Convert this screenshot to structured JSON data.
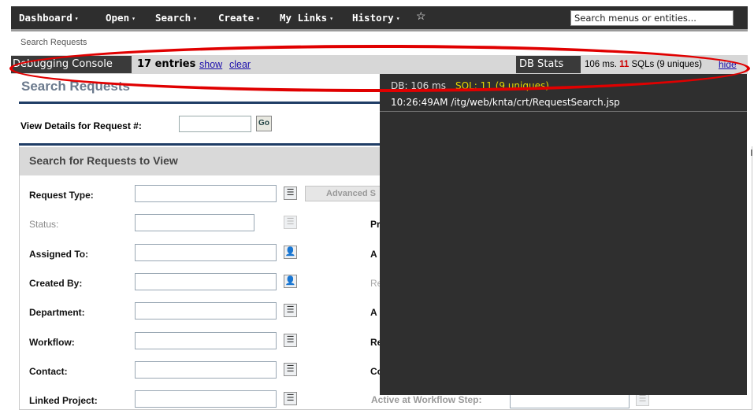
{
  "nav": {
    "menus": [
      {
        "label": "Dashboard"
      },
      {
        "label": "Open"
      },
      {
        "label": "Search"
      },
      {
        "label": "Create"
      },
      {
        "label": "My Links"
      },
      {
        "label": "History"
      }
    ],
    "caret": "▾",
    "star_icon": "☆",
    "search_value": "Search menus or entities..."
  },
  "breadcrumb": "Search Requests",
  "debug": {
    "title": "Debugging Console",
    "entries": "17 entries",
    "show": "show",
    "clear": "clear",
    "dbstats_label": "DB Stats",
    "ms": "106 ms.",
    "sql_count": "11",
    "sql_rest": "SQLs (9 uniques)",
    "hide": "hide",
    "overlay_db": "DB: 106 ms",
    "overlay_sql": "SQL: 11 (9 uniques)",
    "overlay_path": "10:26:49AM /itg/web/knta/crt/RequestSearch.jsp"
  },
  "page": {
    "title": "Search Requests",
    "view_details_label": "View Details for Request #:",
    "go": "Go",
    "section_title": "Search for Requests to View",
    "advanced": "Advanced S",
    "fields": [
      {
        "label": "Request Type:"
      },
      {
        "label": "Status:"
      },
      {
        "label": "Assigned To:"
      },
      {
        "label": "Created By:"
      },
      {
        "label": "Department:"
      },
      {
        "label": "Workflow:"
      },
      {
        "label": "Contact:"
      },
      {
        "label": "Linked Project:"
      }
    ],
    "right_fields": [
      "Pr",
      "A",
      "Re",
      "A",
      "Re",
      "Co"
    ],
    "active_step_label": "Active at Workflow Step:"
  },
  "icons": {
    "list": "☰",
    "user": "👤"
  }
}
